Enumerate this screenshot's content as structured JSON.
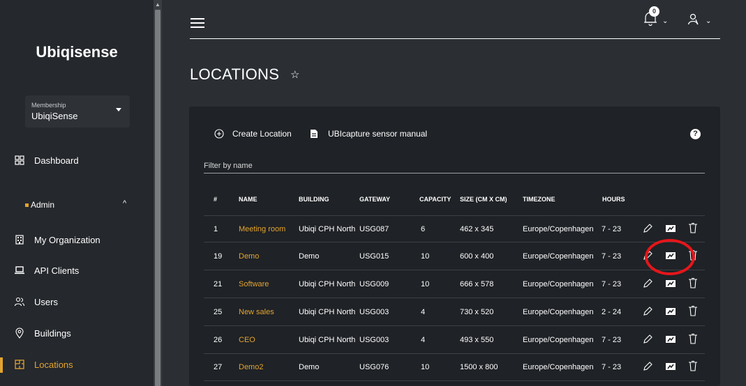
{
  "sidebar": {
    "brand": "Ubiqisense",
    "membership": {
      "label": "Membership",
      "value": "UbiqiSense"
    },
    "dashboard": "Dashboard",
    "admin": "Admin",
    "items": [
      {
        "label": "My Organization",
        "icon": "building-icon"
      },
      {
        "label": "API Clients",
        "icon": "laptop-icon"
      },
      {
        "label": "Users",
        "icon": "users-icon"
      },
      {
        "label": "Buildings",
        "icon": "location-pin-icon"
      },
      {
        "label": "Locations",
        "icon": "floorplan-icon",
        "active": true
      }
    ]
  },
  "topbar": {
    "notification_count": "0"
  },
  "page": {
    "title": "LOCATIONS"
  },
  "toolbar": {
    "create_label": "Create Location",
    "manual_label": "UBIcapture sensor manual",
    "help_label": "?"
  },
  "filter": {
    "placeholder": "Filter by name"
  },
  "table": {
    "headers": [
      "#",
      "NAME",
      "BUILDING",
      "GATEWAY",
      "CAPACITY",
      "SIZE (CM X CM)",
      "TIMEZONE",
      "HOURS"
    ],
    "rows": [
      {
        "id": "1",
        "name": "Meeting room",
        "building": "Ubiqi CPH North",
        "gateway": "USG087",
        "capacity": "6",
        "size": "462 x 345",
        "timezone": "Europe/Copenhagen",
        "hours": "7 - 23"
      },
      {
        "id": "19",
        "name": "Demo",
        "building": "Demo",
        "gateway": "USG015",
        "capacity": "10",
        "size": "600 x 400",
        "timezone": "Europe/Copenhagen",
        "hours": "7 - 23"
      },
      {
        "id": "21",
        "name": "Software",
        "building": "Ubiqi CPH North",
        "gateway": "USG009",
        "capacity": "10",
        "size": "666 x 578",
        "timezone": "Europe/Copenhagen",
        "hours": "7 - 23"
      },
      {
        "id": "25",
        "name": "New sales",
        "building": "Ubiqi CPH North",
        "gateway": "USG003",
        "capacity": "4",
        "size": "730 x 520",
        "timezone": "Europe/Copenhagen",
        "hours": "2 - 24"
      },
      {
        "id": "26",
        "name": "CEO",
        "building": "Ubiqi CPH North",
        "gateway": "USG003",
        "capacity": "4",
        "size": "493 x 550",
        "timezone": "Europe/Copenhagen",
        "hours": "7 - 23"
      },
      {
        "id": "27",
        "name": "Demo2",
        "building": "Demo",
        "gateway": "USG076",
        "capacity": "10",
        "size": "1500 x 800",
        "timezone": "Europe/Copenhagen",
        "hours": "7 - 23"
      }
    ]
  },
  "colors": {
    "accent": "#e3a42f",
    "annotation": "#e5161b",
    "card": "#1f2226",
    "background": "#2b2f34"
  }
}
